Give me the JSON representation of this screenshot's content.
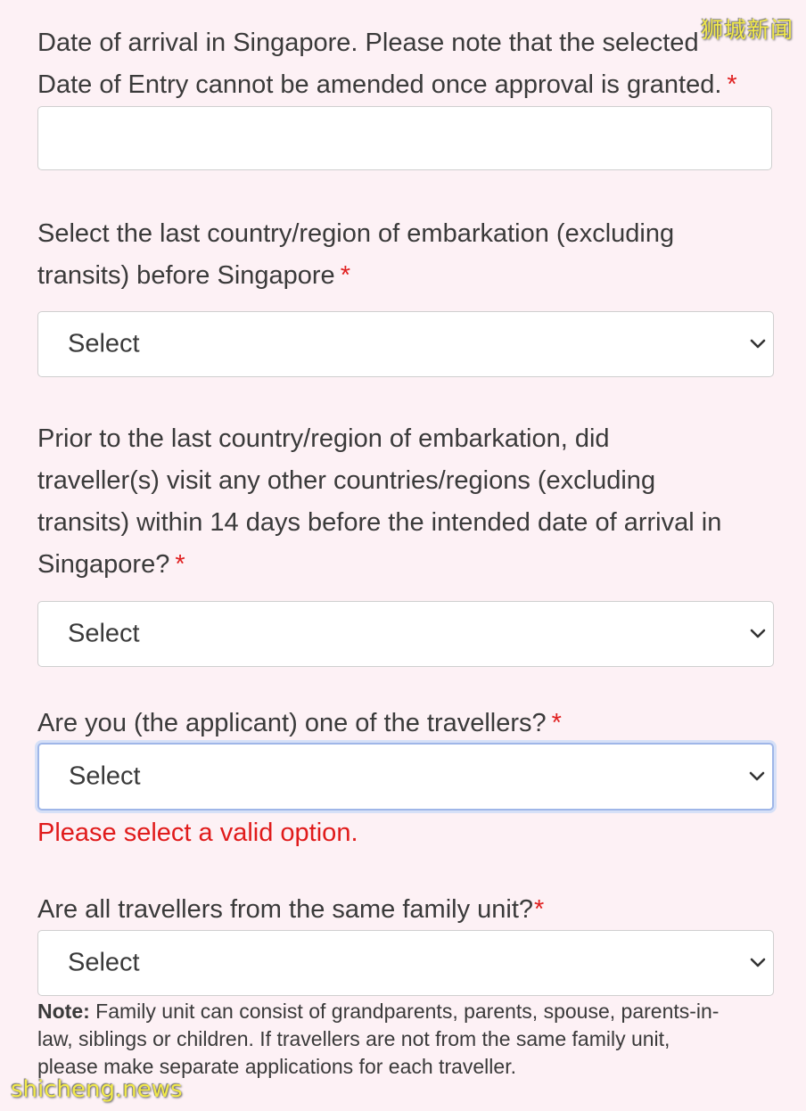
{
  "watermarks": {
    "top": "狮城新闻",
    "bottom": "shicheng.news"
  },
  "fields": {
    "arrival_date": {
      "label_line1": "Date of arrival in Singapore. Please note that the selected",
      "label_line2": "Date of Entry cannot be amended once approval is granted.",
      "required_mark": "*",
      "value": ""
    },
    "last_country": {
      "label_line1": "Select the last country/region of embarkation (excluding",
      "label_line2": "transits) before Singapore",
      "required_mark": "*",
      "selected": "Select"
    },
    "other_countries": {
      "label_line1": "Prior to the last country/region of embarkation, did",
      "label_line2": "traveller(s) visit any other countries/regions (excluding",
      "label_line3": "transits) within 14 days before the intended date of arrival in",
      "label_line4": "Singapore?",
      "required_mark": "*",
      "selected": "Select"
    },
    "applicant_traveller": {
      "label": "Are you (the applicant) one of the travellers?",
      "required_mark": "*",
      "selected": "Select",
      "error": "Please select a valid option."
    },
    "family_unit": {
      "label": "Are all travellers from the same family unit?",
      "required_mark": "*",
      "selected": "Select",
      "note_prefix": "Note:",
      "note_line1": " Family unit can consist of grandparents, parents, spouse, parents-in-",
      "note_line2": "law, siblings or children. If travellers are not from the same family unit,",
      "note_line3": "please make separate applications for each traveller."
    }
  },
  "icons": {
    "select_arrow": "chevron-down-icon"
  },
  "colors": {
    "background": "#fdf1f5",
    "required": "#e02020",
    "error": "#e01b1b",
    "focus_border": "#9fb6e8",
    "watermark": "#f2e94a"
  }
}
